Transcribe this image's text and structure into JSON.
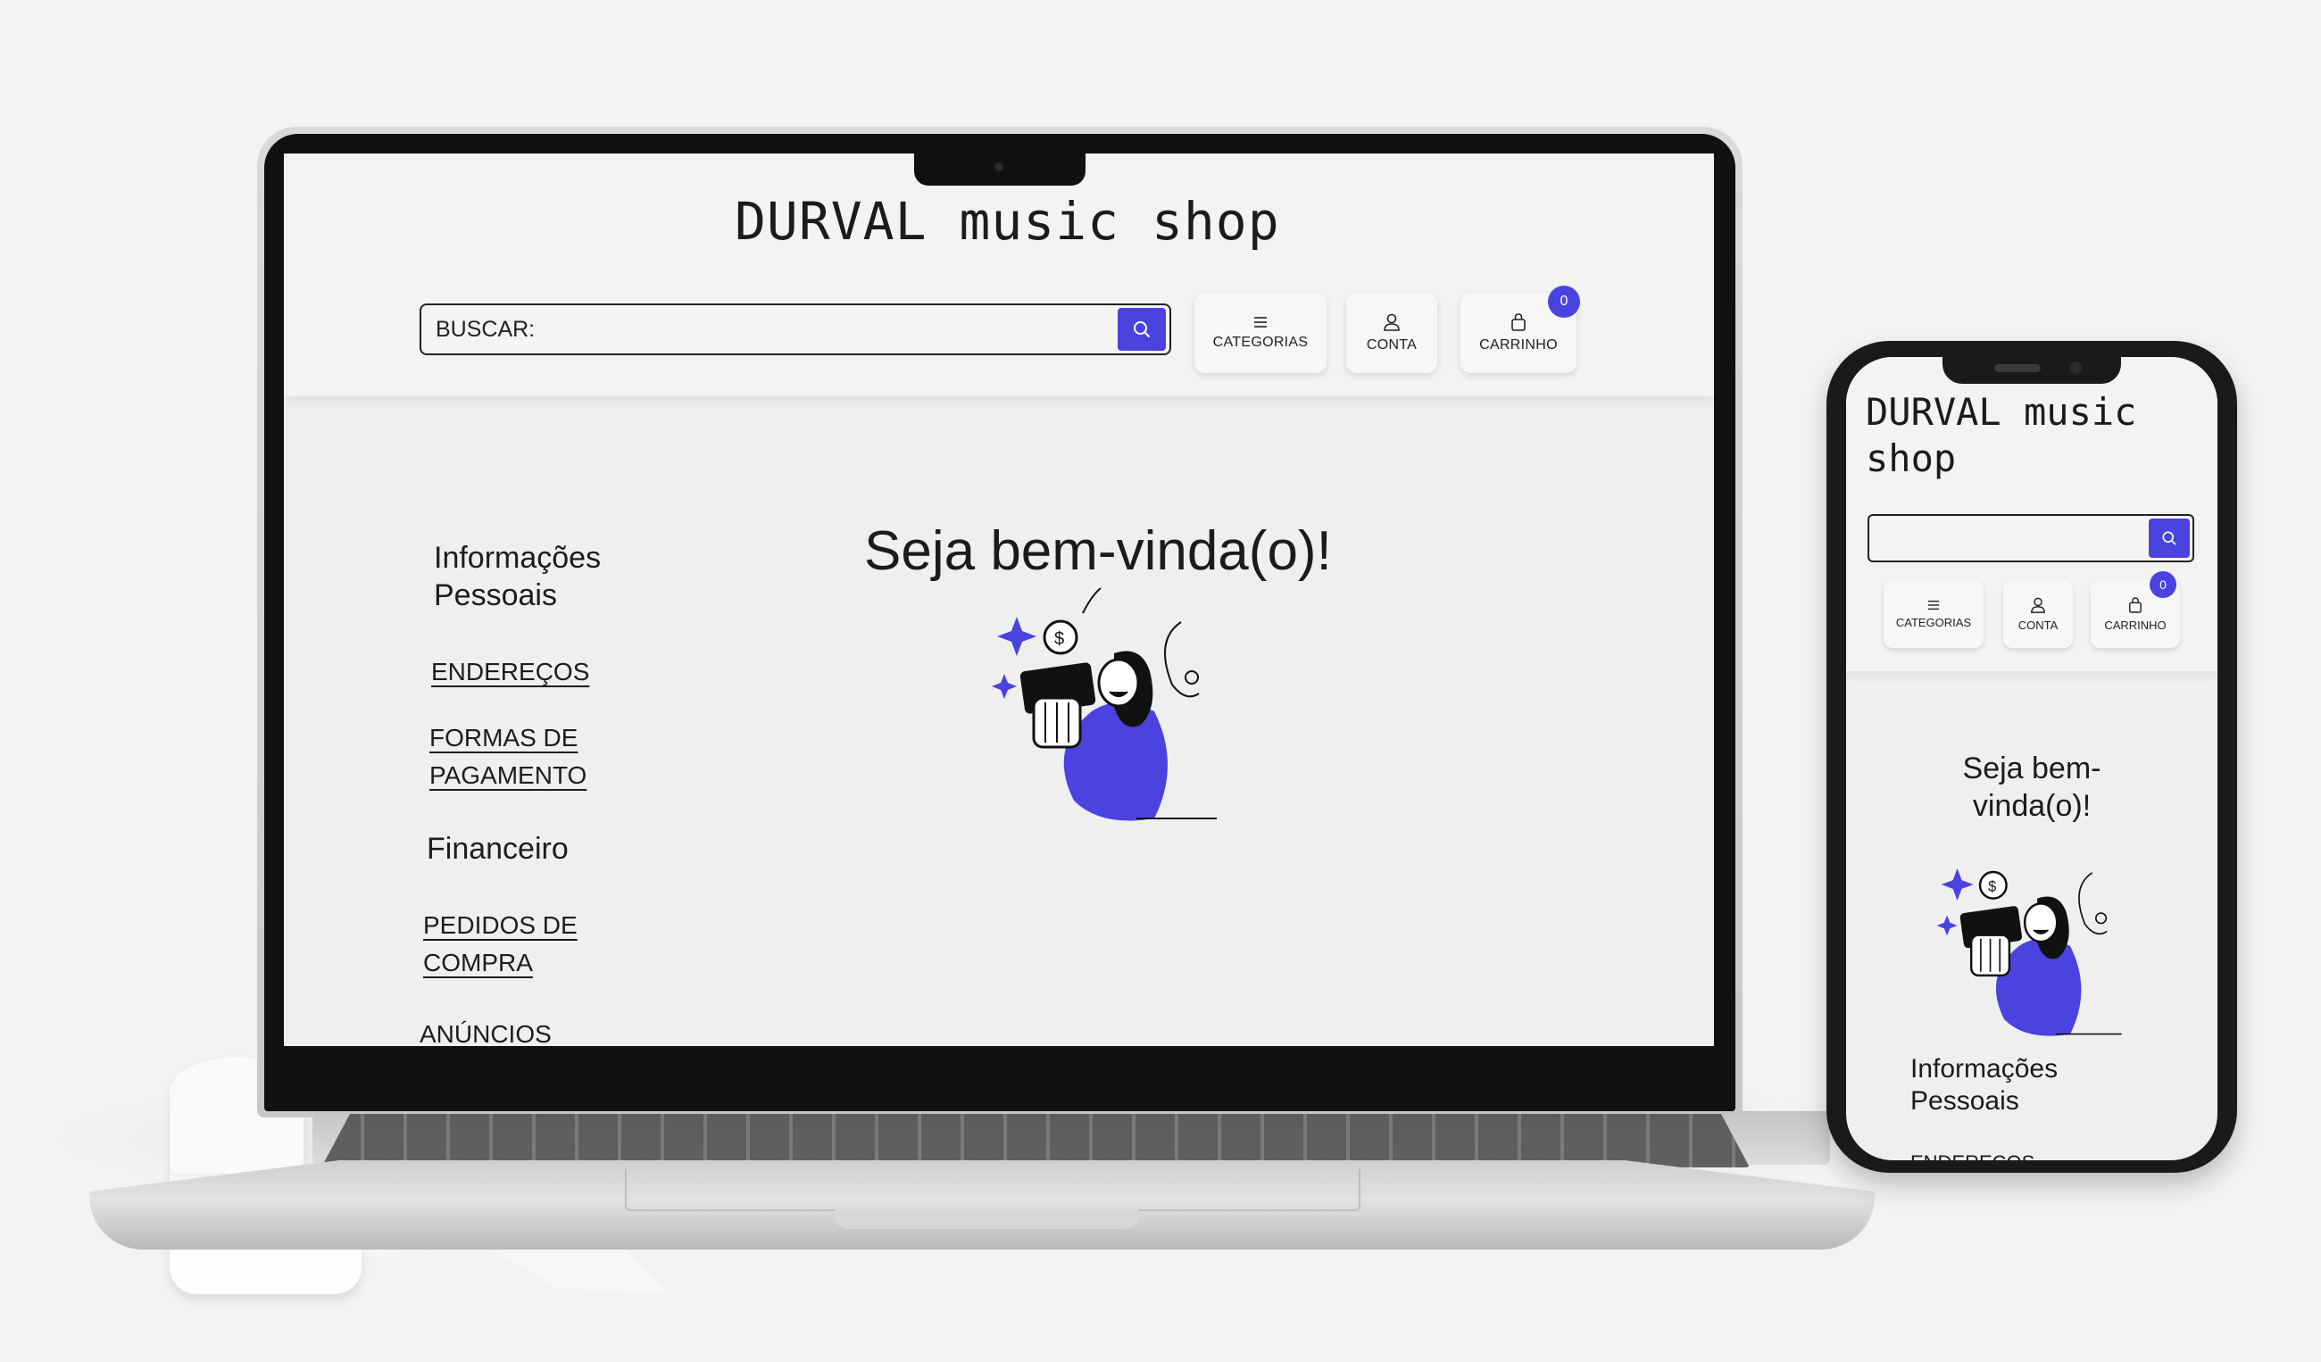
{
  "site": {
    "logo": "DURVAL music shop",
    "logo_line1": "DURVAL music",
    "logo_line2": "shop"
  },
  "search": {
    "placeholder": "BUSCAR:",
    "button_icon": "search-icon"
  },
  "nav": {
    "categorias": {
      "label": "CATEGORIAS",
      "icon": "menu-icon"
    },
    "conta": {
      "label": "CONTA",
      "icon": "user-icon"
    },
    "carrinho": {
      "label": "CARRINHO",
      "icon": "shopping-bag-icon",
      "count": "0"
    }
  },
  "main": {
    "welcome": "Seja bem-vinda(o)!",
    "welcome_line1": "Seja bem-",
    "welcome_line2": "vinda(o)!"
  },
  "sidebar": {
    "personal_heading": "Informações Pessoais",
    "personal_line1": "Informações",
    "personal_line2": "Pessoais",
    "enderecos": "ENDEREÇOS",
    "formas_line1": "FORMAS DE",
    "formas_line2": "PAGAMENTO",
    "financeiro": "Financeiro",
    "pedidos_line1": "PEDIDOS DE",
    "pedidos_line2": "COMPRA",
    "anuncios": "ANÚNCIOS"
  },
  "colors": {
    "accent": "#4a43e0",
    "background": "#efeff0",
    "text": "#1b1b1b"
  }
}
